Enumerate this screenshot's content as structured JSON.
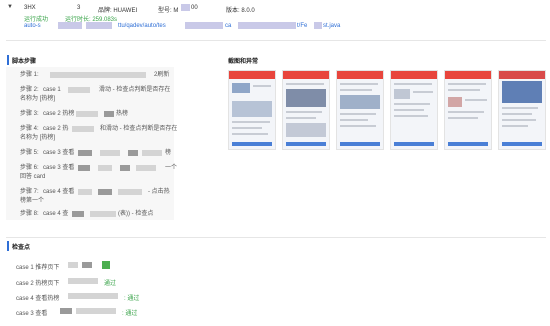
{
  "header": {
    "caret": "▼",
    "device_code": "3HX",
    "device_num": "3",
    "brand_label": "品牌: HUAWEI",
    "model_label": "型号: M",
    "model_tail": "00",
    "version_label": "版本: 8.0.0",
    "status": "运行成功",
    "duration": "运行时长: 259.083s",
    "prefix": "auto-s",
    "path_mid": "ttu/qadev/auto/tes",
    "path_ca": "ca",
    "path_end": "t/Fe",
    "path_ext": "st.java"
  },
  "steps_section": {
    "title": "脚本步骤",
    "steps": [
      {
        "num": "步骤 1:",
        "text": "",
        "tail": "2刷新"
      },
      {
        "num": "步骤 2:",
        "text": "case 1",
        "tail": "滑动 - 检查点判断是否存在"
      },
      {
        "num": "",
        "text": "名称为 [热榜]",
        "tail": ""
      },
      {
        "num": "步骤 3:",
        "text": "case 2 热榜",
        "tail": "热榜"
      },
      {
        "num": "步骤 4:",
        "text": "case 2 热",
        "tail": "和滑动 - 检查点判断是否存在"
      },
      {
        "num": "",
        "text": "名称为 [热榜]",
        "tail": ""
      },
      {
        "num": "步骤 5:",
        "text": "case 3 查看",
        "tail": "榜"
      },
      {
        "num": "步骤 6:",
        "text": "case 3 查看",
        "tail": "一个"
      },
      {
        "num": "",
        "text": "回答 card",
        "tail": ""
      },
      {
        "num": "步骤 7:",
        "text": "case 4 查看",
        "tail": "- 点击热"
      },
      {
        "num": "",
        "text": "榜第一个",
        "tail": ""
      },
      {
        "num": "步骤 8:",
        "text": "case 4 查",
        "tail": "(表)) - 检查点"
      }
    ]
  },
  "screenshots_section": {
    "title": "截图和异常",
    "count": 6
  },
  "checks_section": {
    "title": "检查点",
    "items": [
      {
        "text": "case 1 推荐页下",
        "result": ""
      },
      {
        "text": "case 2 热榜页下",
        "result": "通过"
      },
      {
        "text": "case 4 查看热榜",
        "result": ": 通过"
      },
      {
        "text": "case 3 查看",
        "result": ": 通过"
      }
    ]
  },
  "colors": {
    "accent": "#2f6fd6",
    "success": "#3aa44a",
    "blur": "#c9c9e8"
  }
}
